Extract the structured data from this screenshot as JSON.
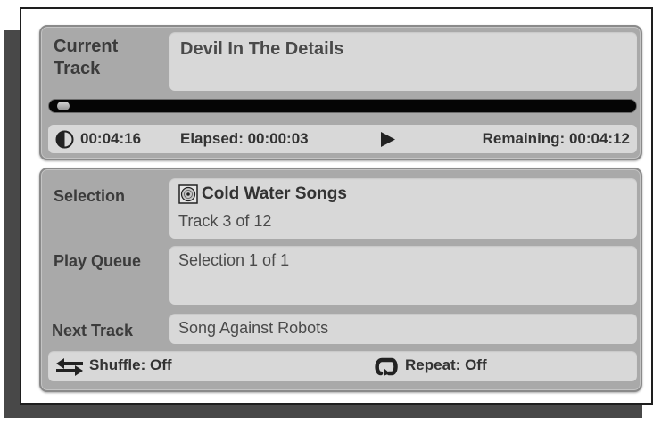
{
  "now_playing": {
    "current_track_label": "Current Track",
    "track_title": "Devil In The Details",
    "progress_fraction": 0.01,
    "duration": "00:04:16",
    "elapsed": "Elapsed: 00:00:03",
    "remaining": "Remaining: 00:04:12"
  },
  "queue": {
    "selection_label": "Selection",
    "selection_name": "Cold Water Songs",
    "selection_track": "Track 3 of 12",
    "play_queue_label": "Play Queue",
    "play_queue_value": "Selection 1 of 1",
    "next_track_label": "Next Track",
    "next_track_value": "Song Against Robots",
    "shuffle": "Shuffle: Off",
    "repeat": "Repeat: Off"
  },
  "icons": {
    "duration": "clock-icon",
    "play": "play-icon",
    "selection": "disc-icon",
    "shuffle": "shuffle-icon",
    "repeat": "repeat-icon"
  }
}
